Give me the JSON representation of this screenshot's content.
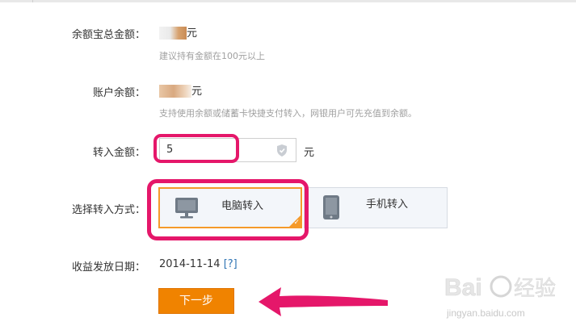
{
  "form": {
    "balance_total": {
      "label": "余额宝总金额：",
      "unit": "元",
      "hint": "建议持有金额在100元以上"
    },
    "account_balance": {
      "label": "账户余额：",
      "unit": "元",
      "hint": "支持使用余额或储蓄卡快捷支付转入，网银用户可先充值到余额。"
    },
    "amount": {
      "label": "转入金额：",
      "value": "5",
      "unit": "元"
    },
    "method": {
      "label": "选择转入方式：",
      "options": [
        {
          "label": "电脑转入",
          "icon": "monitor-icon",
          "selected": true
        },
        {
          "label": "手机转入",
          "icon": "phone-icon",
          "selected": false
        }
      ]
    },
    "date": {
      "label": "收益发放日期：",
      "value": "2014-11-14",
      "help": "[?]"
    },
    "next_button": "下一步"
  },
  "watermark": {
    "brand": "Baidu经验",
    "url": "jingyan.baidu.com"
  },
  "colors": {
    "accent_orange": "#f08300",
    "highlight_pink": "#e5176a",
    "link_blue": "#2f74b4"
  }
}
